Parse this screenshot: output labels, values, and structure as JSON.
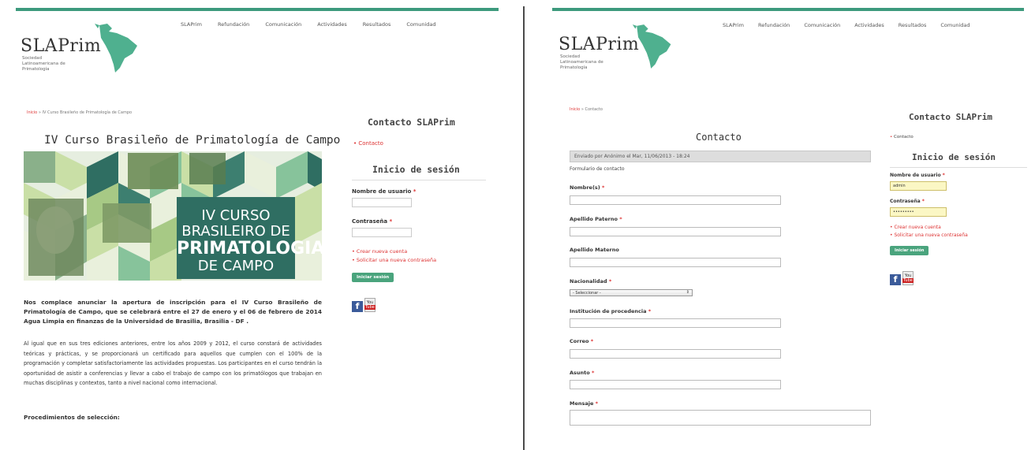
{
  "site": {
    "logo_text": "SLAPrim",
    "logo_sub": "Sociedad Latinoamericana de Primatología",
    "nav": [
      "SLAPrim",
      "Refundación",
      "Comunicación",
      "Actividades",
      "Resultados",
      "Comunidad"
    ]
  },
  "left": {
    "breadcrumb_home": "Inicio",
    "breadcrumb_rest": " » IV Curso Brasileño de Primatología de Campo",
    "title": "IV Curso Brasileño de Primatología de Campo",
    "banner": {
      "line1": "IV CURSO",
      "line2": "BRASILEIRO DE",
      "line3": "PRIMATOLOGIA",
      "line4": "DE CAMPO"
    },
    "paragraph_bold": "Nos complace anunciar la apertura de inscripción para el IV Curso Brasileño de Primatología de Campo, que se celebrará entre el 27 de enero y el 06 de febrero de 2014 Agua Limpia en finanzas de la Universidad de Brasilia, Brasilia - DF .",
    "paragraph": "Al igual que en sus tres ediciones anteriores, entre los años 2009 y 2012, el curso constará de actividades teóricas y prácticas, y se proporcionará un certificado para aquellos que cumplen con el 100% de la programación y completar satisfactoriamente las actividades propuestas. Los participantes en el curso tendrán la oportunidad de asistir a conferencias y llevar a cabo el trabajo de campo con los primatólogos que trabajan en muchas disciplinas y contextos, tanto a nivel nacional como internacional.",
    "section_heading": "Procedimientos de selección:"
  },
  "right": {
    "breadcrumb_home": "Inicio",
    "breadcrumb_rest": " » Contacto",
    "title": "Contacto",
    "posted": "Enviado por Anónimo el Mar, 11/06/2013 - 18:24",
    "form_caption": "Formulario de contacto",
    "fields": {
      "nombre": "Nombre(s)",
      "apellido_paterno": "Apellido Paterno",
      "apellido_materno": "Apellido Materno",
      "nacionalidad": "Nacionalidad",
      "nacionalidad_value": "- Seleccionar -",
      "institucion": "Institución de procedencia",
      "correo": "Correo",
      "asunto": "Asunto",
      "mensaje": "Mensaje"
    },
    "required_mark": "*"
  },
  "sidebar": {
    "contact_title": "Contacto SLAPrim",
    "contact_link": "Contacto",
    "login_title": "Inicio de sesión",
    "username_label": "Nombre de usuario",
    "password_label": "Contraseña",
    "username_value": "admin",
    "password_value": "•••••••••",
    "create_account": "Crear nueva cuenta",
    "request_password": "Solicitar una nueva contraseña",
    "login_button": "Iniciar sesión",
    "required_mark": "*"
  },
  "colors": {
    "accent": "#3d9a7d",
    "link_red": "#dd3333",
    "banner_dark": "#2f6e62"
  },
  "icons": [
    "south-america-map-icon",
    "facebook-icon",
    "youtube-icon",
    "select-arrow-icon"
  ]
}
